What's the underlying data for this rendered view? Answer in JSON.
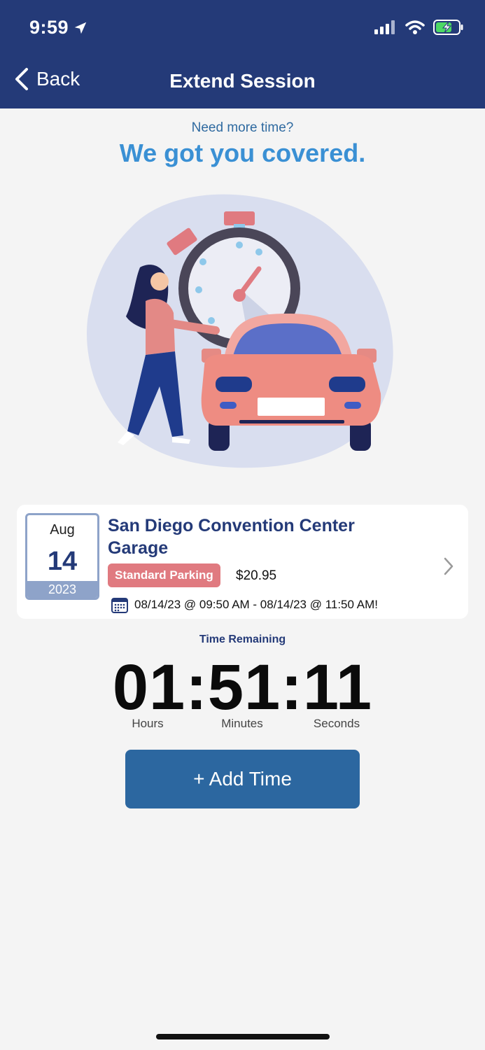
{
  "status_bar": {
    "time": "9:59"
  },
  "nav": {
    "back_label": "Back",
    "title": "Extend Session"
  },
  "promo": {
    "subtitle": "Need more time?",
    "headline": "We got you covered."
  },
  "session_card": {
    "month": "Aug",
    "day": "14",
    "year": "2023",
    "location": "San Diego Convention Center Garage",
    "parking_type": "Standard Parking",
    "price": "$20.95",
    "range": "08/14/23 @ 09:50 AM - 08/14/23 @ 11:50 AM!"
  },
  "timer": {
    "label": "Time Remaining",
    "value": "01:51:11",
    "units": {
      "hours": "Hours",
      "minutes": "Minutes",
      "seconds": "Seconds"
    }
  },
  "actions": {
    "add_time": "+ Add Time"
  },
  "colors": {
    "nav_bg": "#243a78",
    "accent": "#3a90d4",
    "badge": "#e07a80",
    "button": "#2c67a0"
  }
}
